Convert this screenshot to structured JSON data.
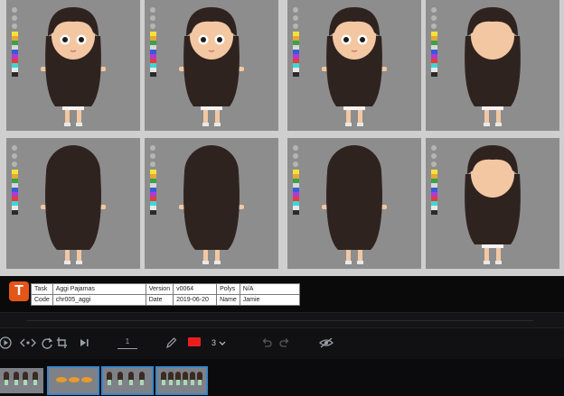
{
  "colors": {
    "panel_bg": "#8d8d8d",
    "hair": "#2f2320",
    "skin": "#f2c7a2",
    "dress": "#a9e0b3",
    "shorts": "#f4f4f4",
    "accent": "#e2561a",
    "selection": "#3a86c8",
    "pen_color": "#e81e1e"
  },
  "swatch_colors": [
    "#f4e23a",
    "#e9a53a",
    "#3aa24a",
    "#d8d8d8",
    "#3a5ad8",
    "#b03ad8",
    "#e83a3a",
    "#3ad8d8",
    "#e8e8e8",
    "#2a2a2a"
  ],
  "logo": {
    "letter": "T"
  },
  "slate": {
    "task_label": "Task",
    "task_value": "Aggi Pajamas",
    "code_label": "Code",
    "code_value": "chr005_aggi",
    "version_label": "Version",
    "version_value": "v0064",
    "date_label": "Date",
    "date_value": "2019-06-20",
    "polys_label": "Polys",
    "polys_value": "N/A",
    "name_label": "Name",
    "name_value": "Jamie"
  },
  "toolbar": {
    "play_icon": "play-icon",
    "step_icon": "step-icon",
    "loop_icon": "loop-icon",
    "crop_icon": "crop-icon",
    "next_icon": "next-frame-icon",
    "frame_number": "1",
    "pen_icon": "pencil-icon",
    "brush_size": "3",
    "undo_icon": "undo-icon",
    "redo_icon": "redo-icon",
    "visibility_icon": "eye-slash-icon"
  },
  "panels": [
    "front-left",
    "front",
    "front-right",
    "right",
    "back-left",
    "back",
    "back-right",
    "left"
  ],
  "thumbnails": [
    {
      "kind": "characters",
      "selected": false
    },
    {
      "kind": "fish",
      "selected": true
    },
    {
      "kind": "characters",
      "selected": true
    },
    {
      "kind": "characters-small",
      "selected": true
    }
  ]
}
